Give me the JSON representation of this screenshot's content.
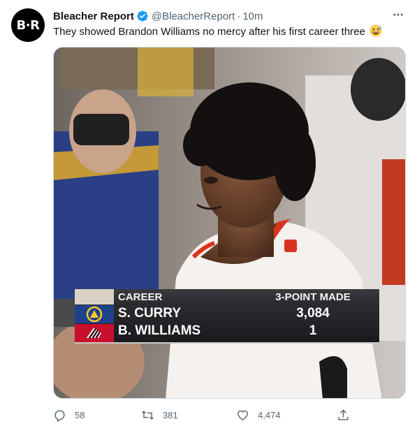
{
  "author": {
    "avatar_text": "B·R",
    "name": "Bleacher Report",
    "handle": "@BleacherReport",
    "separator": "·",
    "time": "10m"
  },
  "tweet": {
    "text": "They showed Brandon Williams no mercy after his first career three"
  },
  "scorebug": {
    "category": "CAREER",
    "stat": "3-POINT MADE",
    "rows": [
      {
        "player": "S. CURRY",
        "value": "3,084",
        "team_color": "#1d428a"
      },
      {
        "player": "B. WILLIAMS",
        "value": "1",
        "team_color": "#c8102e"
      }
    ]
  },
  "actions": {
    "replies": "58",
    "retweets": "381",
    "likes": "4,474"
  },
  "icons": {
    "verified": "verified-badge-icon",
    "more": "more-dots-icon",
    "emoji": "grinning-sweat-emoji-icon",
    "reply": "reply-icon",
    "retweet": "retweet-icon",
    "like": "heart-icon",
    "share": "share-icon"
  },
  "colors": {
    "accent": "#1d9bf0",
    "muted": "#536471",
    "text": "#0f1419"
  }
}
